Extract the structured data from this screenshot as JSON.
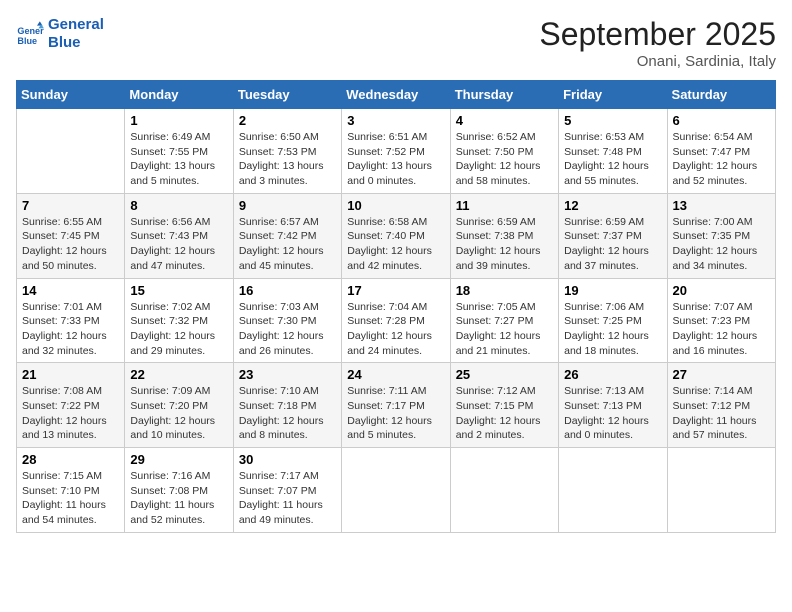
{
  "header": {
    "logo_line1": "General",
    "logo_line2": "Blue",
    "month_title": "September 2025",
    "location": "Onani, Sardinia, Italy"
  },
  "weekdays": [
    "Sunday",
    "Monday",
    "Tuesday",
    "Wednesday",
    "Thursday",
    "Friday",
    "Saturday"
  ],
  "weeks": [
    [
      {
        "day": "",
        "sunrise": "",
        "sunset": "",
        "daylight": ""
      },
      {
        "day": "1",
        "sunrise": "Sunrise: 6:49 AM",
        "sunset": "Sunset: 7:55 PM",
        "daylight": "Daylight: 13 hours and 5 minutes."
      },
      {
        "day": "2",
        "sunrise": "Sunrise: 6:50 AM",
        "sunset": "Sunset: 7:53 PM",
        "daylight": "Daylight: 13 hours and 3 minutes."
      },
      {
        "day": "3",
        "sunrise": "Sunrise: 6:51 AM",
        "sunset": "Sunset: 7:52 PM",
        "daylight": "Daylight: 13 hours and 0 minutes."
      },
      {
        "day": "4",
        "sunrise": "Sunrise: 6:52 AM",
        "sunset": "Sunset: 7:50 PM",
        "daylight": "Daylight: 12 hours and 58 minutes."
      },
      {
        "day": "5",
        "sunrise": "Sunrise: 6:53 AM",
        "sunset": "Sunset: 7:48 PM",
        "daylight": "Daylight: 12 hours and 55 minutes."
      },
      {
        "day": "6",
        "sunrise": "Sunrise: 6:54 AM",
        "sunset": "Sunset: 7:47 PM",
        "daylight": "Daylight: 12 hours and 52 minutes."
      }
    ],
    [
      {
        "day": "7",
        "sunrise": "Sunrise: 6:55 AM",
        "sunset": "Sunset: 7:45 PM",
        "daylight": "Daylight: 12 hours and 50 minutes."
      },
      {
        "day": "8",
        "sunrise": "Sunrise: 6:56 AM",
        "sunset": "Sunset: 7:43 PM",
        "daylight": "Daylight: 12 hours and 47 minutes."
      },
      {
        "day": "9",
        "sunrise": "Sunrise: 6:57 AM",
        "sunset": "Sunset: 7:42 PM",
        "daylight": "Daylight: 12 hours and 45 minutes."
      },
      {
        "day": "10",
        "sunrise": "Sunrise: 6:58 AM",
        "sunset": "Sunset: 7:40 PM",
        "daylight": "Daylight: 12 hours and 42 minutes."
      },
      {
        "day": "11",
        "sunrise": "Sunrise: 6:59 AM",
        "sunset": "Sunset: 7:38 PM",
        "daylight": "Daylight: 12 hours and 39 minutes."
      },
      {
        "day": "12",
        "sunrise": "Sunrise: 6:59 AM",
        "sunset": "Sunset: 7:37 PM",
        "daylight": "Daylight: 12 hours and 37 minutes."
      },
      {
        "day": "13",
        "sunrise": "Sunrise: 7:00 AM",
        "sunset": "Sunset: 7:35 PM",
        "daylight": "Daylight: 12 hours and 34 minutes."
      }
    ],
    [
      {
        "day": "14",
        "sunrise": "Sunrise: 7:01 AM",
        "sunset": "Sunset: 7:33 PM",
        "daylight": "Daylight: 12 hours and 32 minutes."
      },
      {
        "day": "15",
        "sunrise": "Sunrise: 7:02 AM",
        "sunset": "Sunset: 7:32 PM",
        "daylight": "Daylight: 12 hours and 29 minutes."
      },
      {
        "day": "16",
        "sunrise": "Sunrise: 7:03 AM",
        "sunset": "Sunset: 7:30 PM",
        "daylight": "Daylight: 12 hours and 26 minutes."
      },
      {
        "day": "17",
        "sunrise": "Sunrise: 7:04 AM",
        "sunset": "Sunset: 7:28 PM",
        "daylight": "Daylight: 12 hours and 24 minutes."
      },
      {
        "day": "18",
        "sunrise": "Sunrise: 7:05 AM",
        "sunset": "Sunset: 7:27 PM",
        "daylight": "Daylight: 12 hours and 21 minutes."
      },
      {
        "day": "19",
        "sunrise": "Sunrise: 7:06 AM",
        "sunset": "Sunset: 7:25 PM",
        "daylight": "Daylight: 12 hours and 18 minutes."
      },
      {
        "day": "20",
        "sunrise": "Sunrise: 7:07 AM",
        "sunset": "Sunset: 7:23 PM",
        "daylight": "Daylight: 12 hours and 16 minutes."
      }
    ],
    [
      {
        "day": "21",
        "sunrise": "Sunrise: 7:08 AM",
        "sunset": "Sunset: 7:22 PM",
        "daylight": "Daylight: 12 hours and 13 minutes."
      },
      {
        "day": "22",
        "sunrise": "Sunrise: 7:09 AM",
        "sunset": "Sunset: 7:20 PM",
        "daylight": "Daylight: 12 hours and 10 minutes."
      },
      {
        "day": "23",
        "sunrise": "Sunrise: 7:10 AM",
        "sunset": "Sunset: 7:18 PM",
        "daylight": "Daylight: 12 hours and 8 minutes."
      },
      {
        "day": "24",
        "sunrise": "Sunrise: 7:11 AM",
        "sunset": "Sunset: 7:17 PM",
        "daylight": "Daylight: 12 hours and 5 minutes."
      },
      {
        "day": "25",
        "sunrise": "Sunrise: 7:12 AM",
        "sunset": "Sunset: 7:15 PM",
        "daylight": "Daylight: 12 hours and 2 minutes."
      },
      {
        "day": "26",
        "sunrise": "Sunrise: 7:13 AM",
        "sunset": "Sunset: 7:13 PM",
        "daylight": "Daylight: 12 hours and 0 minutes."
      },
      {
        "day": "27",
        "sunrise": "Sunrise: 7:14 AM",
        "sunset": "Sunset: 7:12 PM",
        "daylight": "Daylight: 11 hours and 57 minutes."
      }
    ],
    [
      {
        "day": "28",
        "sunrise": "Sunrise: 7:15 AM",
        "sunset": "Sunset: 7:10 PM",
        "daylight": "Daylight: 11 hours and 54 minutes."
      },
      {
        "day": "29",
        "sunrise": "Sunrise: 7:16 AM",
        "sunset": "Sunset: 7:08 PM",
        "daylight": "Daylight: 11 hours and 52 minutes."
      },
      {
        "day": "30",
        "sunrise": "Sunrise: 7:17 AM",
        "sunset": "Sunset: 7:07 PM",
        "daylight": "Daylight: 11 hours and 49 minutes."
      },
      {
        "day": "",
        "sunrise": "",
        "sunset": "",
        "daylight": ""
      },
      {
        "day": "",
        "sunrise": "",
        "sunset": "",
        "daylight": ""
      },
      {
        "day": "",
        "sunrise": "",
        "sunset": "",
        "daylight": ""
      },
      {
        "day": "",
        "sunrise": "",
        "sunset": "",
        "daylight": ""
      }
    ]
  ]
}
